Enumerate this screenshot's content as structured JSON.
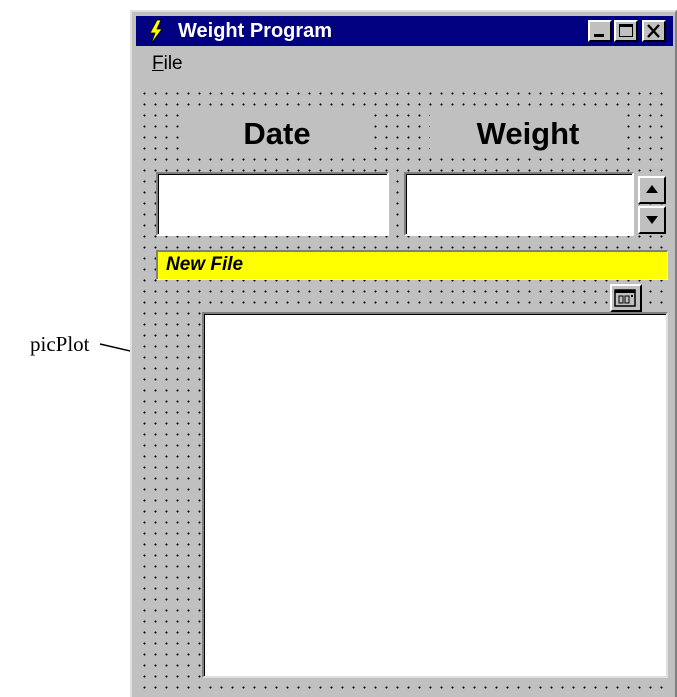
{
  "window": {
    "title": "Weight Program",
    "buttons": {
      "minimize": "minimize",
      "maximize": "maximize",
      "close": "close"
    }
  },
  "menu": {
    "file_rest": "ile",
    "file_mnemonic": "F"
  },
  "form": {
    "date_label": "Date",
    "weight_label": "Weight",
    "date_value": "",
    "weight_value": "",
    "status_text": "New File"
  },
  "annotation": {
    "label": "picPlot"
  },
  "colors": {
    "titlebar": "#000080",
    "status_bg": "#ffff00",
    "face": "#c0c0c0"
  }
}
